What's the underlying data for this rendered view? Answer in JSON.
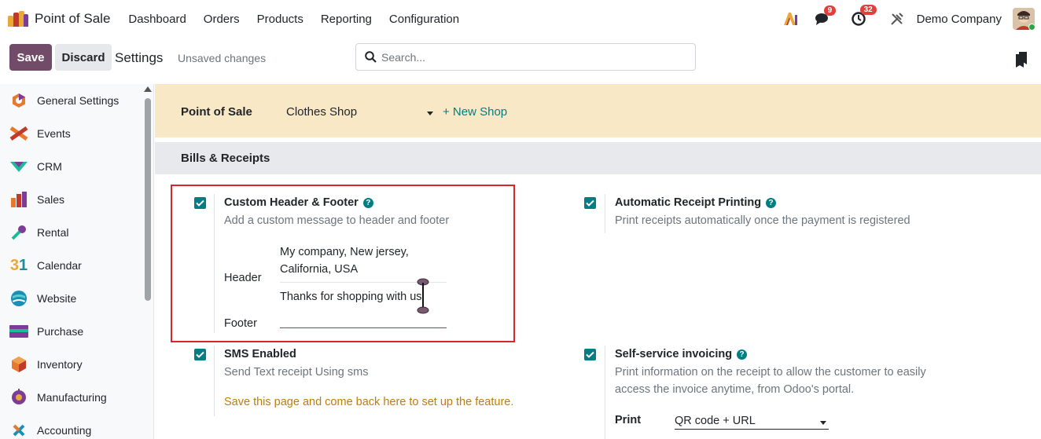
{
  "app": {
    "name": "Point of Sale",
    "menu": [
      "Dashboard",
      "Orders",
      "Products",
      "Reporting",
      "Configuration"
    ],
    "ai_icon": "ai-icon",
    "messages_badge": "9",
    "activities_badge": "32",
    "company": "Demo Company",
    "brand_colors": [
      "#e8a93a",
      "#c0392b",
      "#7d3c98"
    ]
  },
  "control": {
    "save_label": "Save",
    "discard_label": "Discard",
    "title": "Settings",
    "unsaved": "Unsaved changes",
    "search_placeholder": "Search..."
  },
  "sidebar": {
    "items": [
      {
        "label": "General Settings",
        "icon": "general-settings-icon"
      },
      {
        "label": "Events",
        "icon": "events-icon"
      },
      {
        "label": "CRM",
        "icon": "crm-icon"
      },
      {
        "label": "Sales",
        "icon": "sales-icon"
      },
      {
        "label": "Rental",
        "icon": "rental-icon"
      },
      {
        "label": "Calendar",
        "icon": "calendar-icon"
      },
      {
        "label": "Website",
        "icon": "website-icon"
      },
      {
        "label": "Purchase",
        "icon": "purchase-icon"
      },
      {
        "label": "Inventory",
        "icon": "inventory-icon"
      },
      {
        "label": "Manufacturing",
        "icon": "manufacturing-icon"
      },
      {
        "label": "Accounting",
        "icon": "accounting-icon"
      }
    ]
  },
  "shop_band": {
    "label": "Point of Sale",
    "selected_shop": "Clothes Shop",
    "new_shop_link": "+ New Shop"
  },
  "section": {
    "title": "Bills & Receipts"
  },
  "settings": {
    "custom_header_footer": {
      "title": "Custom Header & Footer",
      "description": "Add a custom message to header and footer",
      "checked": true,
      "header_label": "Header",
      "header_value_line1": "My  company, New jersey,",
      "header_value_line2": "California, USA",
      "footer_label": "Footer",
      "footer_value": "Thanks for shopping with us"
    },
    "automatic_receipt": {
      "title": "Automatic Receipt Printing",
      "description": "Print receipts automatically once the payment is registered",
      "checked": true
    },
    "sms_enabled": {
      "title": "SMS Enabled",
      "description": "Send Text receipt Using sms",
      "warning": "Save this page and come back here to set up the feature.",
      "checked": true
    },
    "self_service": {
      "title": "Self-service invoicing",
      "description_line1": "Print information on the receipt to allow the customer to easily",
      "description_line2": "access the invoice anytime, from Odoo's portal.",
      "print_label": "Print",
      "print_value": "QR code + URL",
      "checked": true
    }
  },
  "colors": {
    "primary": "#714b67",
    "accent": "#017e84",
    "warning_text": "#c07c0b",
    "band": "#f9e8c6",
    "highlight": "#d9232d"
  }
}
